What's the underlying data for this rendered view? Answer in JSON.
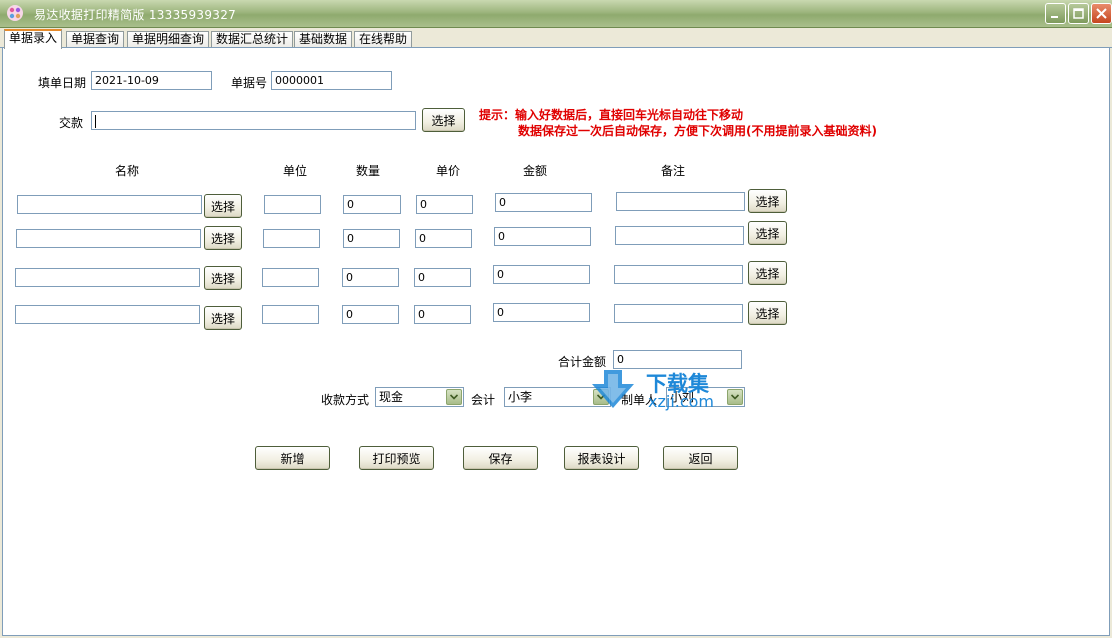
{
  "window": {
    "title": "易达收据打印精简版   13335939327"
  },
  "tabs": [
    {
      "label": "单据录入",
      "active": true
    },
    {
      "label": "单据查询"
    },
    {
      "label": "单据明细查询"
    },
    {
      "label": "数据汇总统计"
    },
    {
      "label": "基础数据"
    },
    {
      "label": "在线帮助"
    }
  ],
  "form": {
    "date_label": "填单日期",
    "date_value": "2021-10-09",
    "number_label": "单据号",
    "number_value": "0000001",
    "payer_label": "交款",
    "payer_value": "",
    "payer_select": "选择"
  },
  "hint": {
    "line1": "提示：输入好数据后，直接回车光标自动往下移动",
    "line2": "数据保存过一次后自动保存，方便下次调用(不用提前录入基础资料)"
  },
  "columns": {
    "name": "名称",
    "unit": "单位",
    "qty": "数量",
    "price": "单价",
    "amount": "金额",
    "remark": "备注"
  },
  "rows": [
    {
      "name": "",
      "select": "选择",
      "unit": "",
      "qty": "0",
      "price": "0",
      "amount": "0",
      "remark": "",
      "remark_select": "选择"
    },
    {
      "name": "",
      "select": "选择",
      "unit": "",
      "qty": "0",
      "price": "0",
      "amount": "0",
      "remark": "",
      "remark_select": "选择"
    },
    {
      "name": "",
      "select": "选择",
      "unit": "",
      "qty": "0",
      "price": "0",
      "amount": "0",
      "remark": "",
      "remark_select": "选择"
    },
    {
      "name": "",
      "select": "选择",
      "unit": "",
      "qty": "0",
      "price": "0",
      "amount": "0",
      "remark": "",
      "remark_select": "选择"
    }
  ],
  "total": {
    "label": "合计金额",
    "value": "0"
  },
  "payment": {
    "method_label": "收款方式",
    "method_value": "现金",
    "accountant_label": "会计",
    "accountant_value": "小李",
    "maker_label": "制单人",
    "maker_value": "小刘"
  },
  "actions": {
    "new": "新增",
    "print_preview": "打印预览",
    "save": "保存",
    "report_design": "报表设计",
    "back": "返回"
  },
  "watermark": {
    "text1": "下载集",
    "text2": "xzji.com"
  }
}
